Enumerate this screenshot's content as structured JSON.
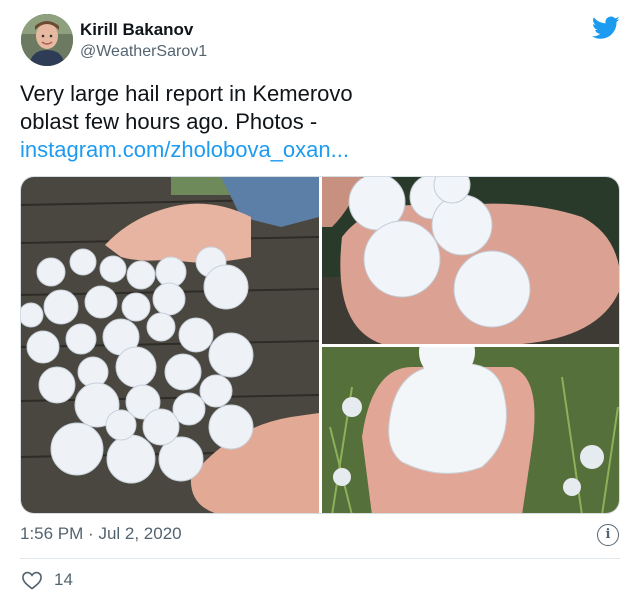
{
  "author": {
    "display_name": "Kirill Bakanov",
    "handle": "@WeatherSarov1"
  },
  "tweet": {
    "text_line1": "Very large hail report in Kemerovo",
    "text_line2": "oblast few hours ago. Photos -",
    "link": "instagram.com/zholobova_oxan..."
  },
  "media": {
    "photo_count": 3
  },
  "meta": {
    "time": "1:56 PM",
    "separator": "·",
    "date": "Jul 2, 2020"
  },
  "actions": {
    "like_count": "14"
  },
  "icons": {
    "brand": "twitter-bird-icon",
    "info": "info-icon",
    "like": "heart-icon"
  },
  "colors": {
    "brand_blue": "#1d9bf0",
    "text": "#0f1419",
    "secondary": "#536471",
    "divider": "#e1e8ed"
  }
}
